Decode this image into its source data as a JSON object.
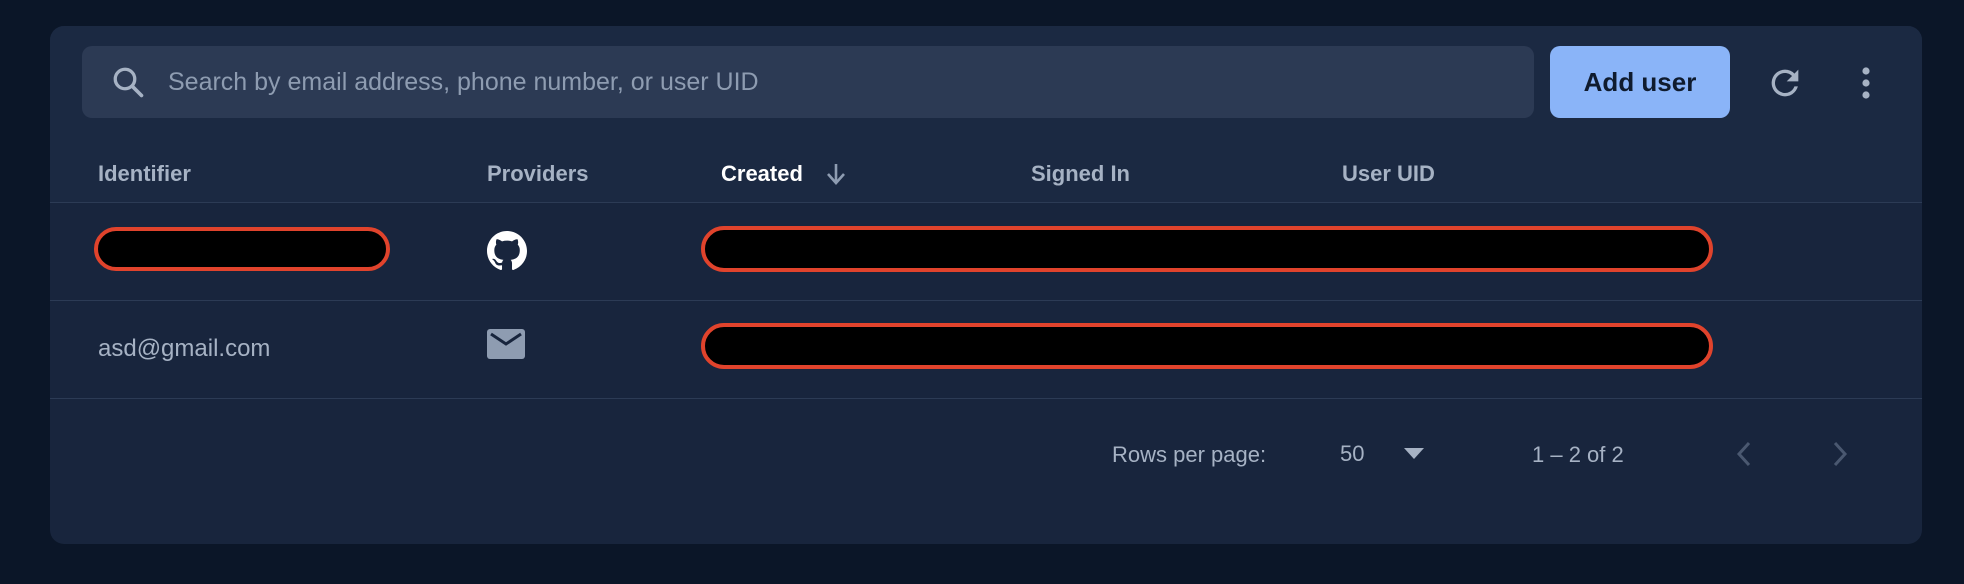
{
  "search": {
    "placeholder": "Search by email address, phone number, or user UID",
    "icon": "search-icon"
  },
  "toolbar": {
    "add_user_label": "Add user",
    "refresh_icon": "refresh-icon",
    "more_icon": "more-vert-icon"
  },
  "table": {
    "columns": [
      {
        "label": "Identifier"
      },
      {
        "label": "Providers"
      },
      {
        "label": "Created",
        "sorted": "descending"
      },
      {
        "label": "Signed In"
      },
      {
        "label": "User UID"
      }
    ],
    "rows": [
      {
        "identifier": "",
        "identifier_redacted": true,
        "provider_icon": "github-icon",
        "details_redacted": true
      },
      {
        "identifier": "asd@gmail.com",
        "identifier_redacted": false,
        "provider_icon": "email-icon",
        "details_redacted": true
      }
    ]
  },
  "pagination": {
    "rows_per_page_label": "Rows per page:",
    "rows_per_page_value": "50",
    "range_text": "1 – 2 of 2"
  },
  "colors": {
    "background": "#0b1628",
    "card": "#18253d",
    "accent": "#8ab4f8",
    "redaction_border": "#e0432c"
  }
}
